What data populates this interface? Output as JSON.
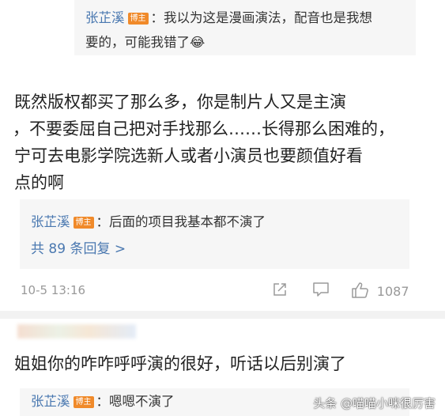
{
  "reply_top": {
    "author": "张芷溪",
    "badge": "博主",
    "text_line1": "：我以为这是漫画演法，配音也是我想",
    "text_line2": "要的，可能我错了😂"
  },
  "comment1": {
    "lines": [
      "既然版权都买了那么多，你是制片人又是主演",
      "，不要委屈自己把对手找那么……长得那么困难的，",
      "宁可去电影学院选新人或者小演员也要颜值好看",
      "点的啊"
    ]
  },
  "reply_mid": {
    "author": "张芷溪",
    "badge": "博主",
    "text": "：后面的项目我基本都不演了",
    "more_replies": "共 89 条回复 >"
  },
  "meta": {
    "timestamp": "10-5 13:16",
    "like_count": "1087"
  },
  "comment2": {
    "text": "姐姐你的咋咋呼呼演的很好，听话以后别演了"
  },
  "reply_bottom": {
    "author": "张芷溪",
    "badge": "博主",
    "text": "：嗯嗯不演了"
  },
  "watermark": "头条 @喵喵小咪很厉害",
  "colors": {
    "author_link": "#4a78b0",
    "badge": "#f08a2a",
    "reply_bg": "#f6f6f6"
  }
}
